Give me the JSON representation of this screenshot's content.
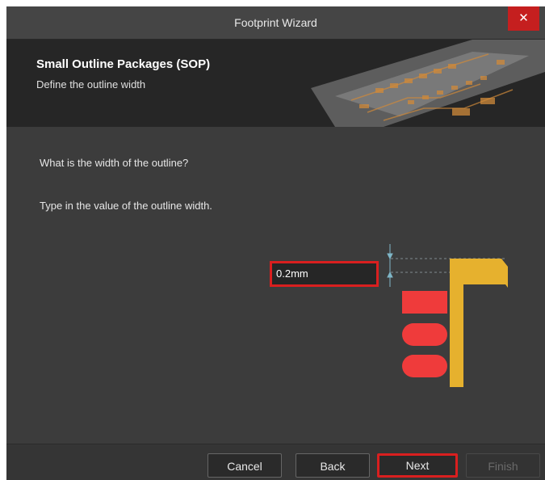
{
  "window": {
    "title": "Footprint Wizard",
    "close_symbol": "✕"
  },
  "banner": {
    "title": "Small Outline Packages (SOP)",
    "subtitle": "Define the outline width"
  },
  "content": {
    "question": "What is the width of the outline?",
    "instruction": "Type in the value of the outline width.",
    "outline_width_value": "0.2mm"
  },
  "diagram": {
    "pad_color": "#ef3b3b",
    "outline_color": "#e6b12e",
    "dimension_color": "#7fb6c7",
    "pad_count": 3
  },
  "footer": {
    "cancel_label": "Cancel",
    "back_label": "Back",
    "next_label": "Next",
    "finish_label": "Finish"
  },
  "colors": {
    "highlight": "#d91f1f",
    "close_button": "#c51f1f",
    "dialog_bg": "#3c3c3c"
  }
}
